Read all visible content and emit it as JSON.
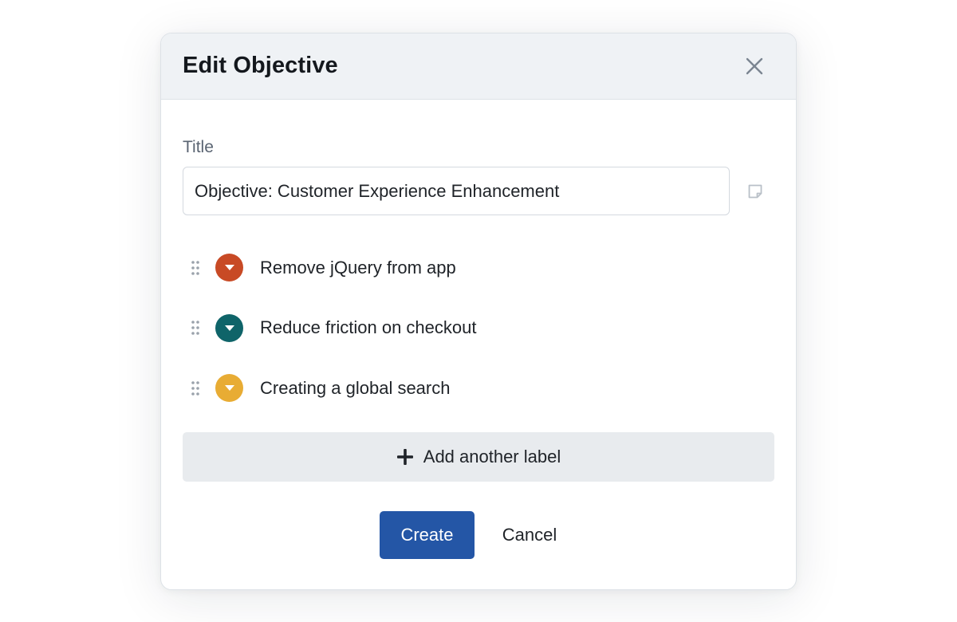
{
  "dialog": {
    "title": "Edit Objective",
    "close_icon": "close-icon"
  },
  "title_field": {
    "label": "Title",
    "value": "Objective: Customer Experience Enhancement",
    "placeholder": "",
    "side_icon": "note-icon"
  },
  "labels": [
    {
      "text": "Remove jQuery from app",
      "color": "#c84a25",
      "icon": "chevron-down-icon"
    },
    {
      "text": "Reduce friction on checkout",
      "color": "#0f6469",
      "icon": "chevron-down-icon"
    },
    {
      "text": "Creating a global search",
      "color": "#e8ac34",
      "icon": "chevron-down-icon"
    }
  ],
  "add_label": {
    "label": "Add another label",
    "icon": "plus-icon"
  },
  "actions": {
    "create_label": "Create",
    "cancel_label": "Cancel"
  },
  "colors": {
    "primary": "#2456a6",
    "header_bg": "#eff2f5",
    "add_button_bg": "#e8ebee"
  }
}
